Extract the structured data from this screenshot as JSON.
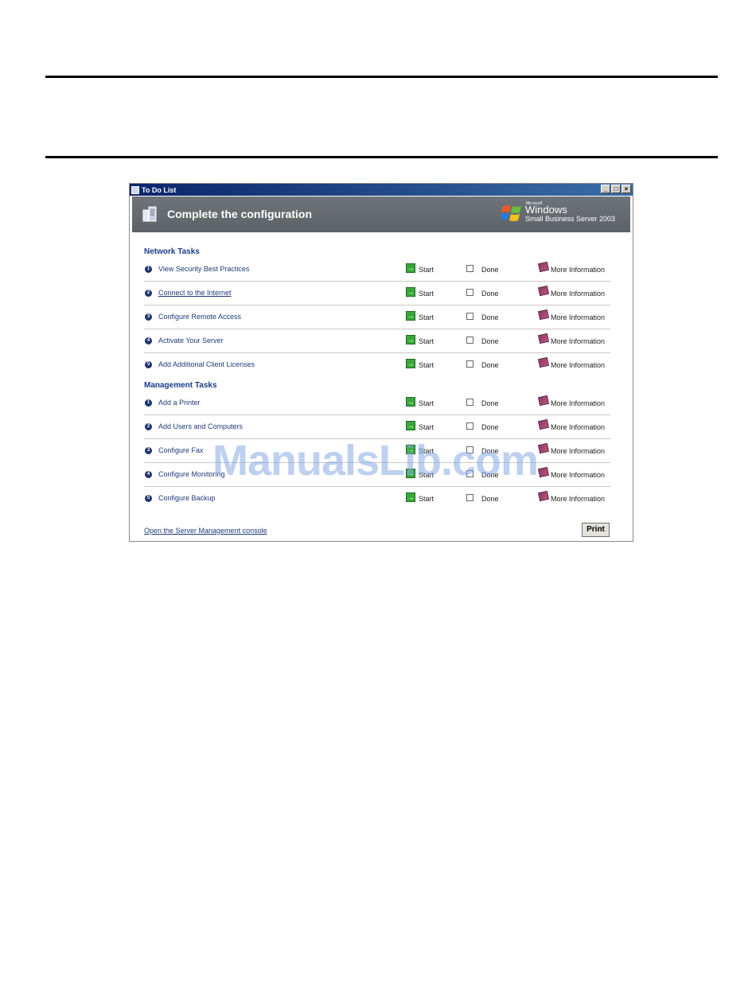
{
  "window": {
    "title": "To Do List",
    "buttons": [
      "_",
      "□",
      "×"
    ]
  },
  "banner": {
    "title": "Complete the configuration",
    "logo": {
      "microsoft": "Microsoft",
      "windows": "Windows",
      "product": "Small Business Server 2003"
    }
  },
  "sections": [
    {
      "title": "Network Tasks",
      "tasks": [
        {
          "num": "1",
          "label": "View Security Best Practices"
        },
        {
          "num": "2",
          "label": "Connect to the Internet"
        },
        {
          "num": "3",
          "label": "Configure Remote Access"
        },
        {
          "num": "4",
          "label": "Activate Your Server"
        },
        {
          "num": "5",
          "label": "Add Additional Client Licenses"
        }
      ]
    },
    {
      "title": "Management Tasks",
      "tasks": [
        {
          "num": "1",
          "label": "Add a Printer"
        },
        {
          "num": "2",
          "label": "Add Users and Computers"
        },
        {
          "num": "3",
          "label": "Configure Fax"
        },
        {
          "num": "4",
          "label": "Configure Monitoring"
        },
        {
          "num": "5",
          "label": "Configure Backup"
        }
      ]
    }
  ],
  "row_actions": {
    "start": "Start",
    "done": "Done",
    "more_info": "More Information"
  },
  "footer": {
    "link": "Open the Server Management console",
    "print": "Print"
  },
  "watermark": "ManualsLib.com"
}
